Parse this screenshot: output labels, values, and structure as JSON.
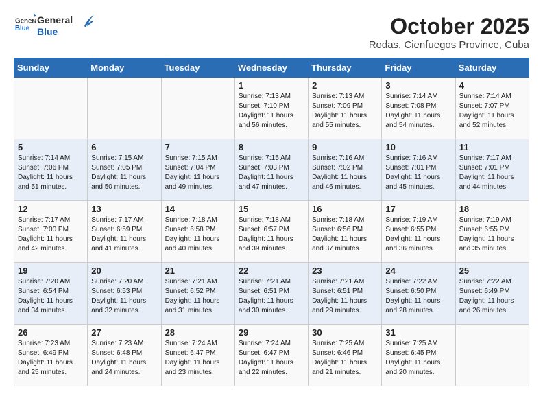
{
  "header": {
    "logo_line1": "General",
    "logo_line2": "Blue",
    "month": "October 2025",
    "location": "Rodas, Cienfuegos Province, Cuba"
  },
  "weekdays": [
    "Sunday",
    "Monday",
    "Tuesday",
    "Wednesday",
    "Thursday",
    "Friday",
    "Saturday"
  ],
  "weeks": [
    [
      {
        "day": "",
        "info": ""
      },
      {
        "day": "",
        "info": ""
      },
      {
        "day": "",
        "info": ""
      },
      {
        "day": "1",
        "info": "Sunrise: 7:13 AM\nSunset: 7:10 PM\nDaylight: 11 hours and 56 minutes."
      },
      {
        "day": "2",
        "info": "Sunrise: 7:13 AM\nSunset: 7:09 PM\nDaylight: 11 hours and 55 minutes."
      },
      {
        "day": "3",
        "info": "Sunrise: 7:14 AM\nSunset: 7:08 PM\nDaylight: 11 hours and 54 minutes."
      },
      {
        "day": "4",
        "info": "Sunrise: 7:14 AM\nSunset: 7:07 PM\nDaylight: 11 hours and 52 minutes."
      }
    ],
    [
      {
        "day": "5",
        "info": "Sunrise: 7:14 AM\nSunset: 7:06 PM\nDaylight: 11 hours and 51 minutes."
      },
      {
        "day": "6",
        "info": "Sunrise: 7:15 AM\nSunset: 7:05 PM\nDaylight: 11 hours and 50 minutes."
      },
      {
        "day": "7",
        "info": "Sunrise: 7:15 AM\nSunset: 7:04 PM\nDaylight: 11 hours and 49 minutes."
      },
      {
        "day": "8",
        "info": "Sunrise: 7:15 AM\nSunset: 7:03 PM\nDaylight: 11 hours and 47 minutes."
      },
      {
        "day": "9",
        "info": "Sunrise: 7:16 AM\nSunset: 7:02 PM\nDaylight: 11 hours and 46 minutes."
      },
      {
        "day": "10",
        "info": "Sunrise: 7:16 AM\nSunset: 7:01 PM\nDaylight: 11 hours and 45 minutes."
      },
      {
        "day": "11",
        "info": "Sunrise: 7:17 AM\nSunset: 7:01 PM\nDaylight: 11 hours and 44 minutes."
      }
    ],
    [
      {
        "day": "12",
        "info": "Sunrise: 7:17 AM\nSunset: 7:00 PM\nDaylight: 11 hours and 42 minutes."
      },
      {
        "day": "13",
        "info": "Sunrise: 7:17 AM\nSunset: 6:59 PM\nDaylight: 11 hours and 41 minutes."
      },
      {
        "day": "14",
        "info": "Sunrise: 7:18 AM\nSunset: 6:58 PM\nDaylight: 11 hours and 40 minutes."
      },
      {
        "day": "15",
        "info": "Sunrise: 7:18 AM\nSunset: 6:57 PM\nDaylight: 11 hours and 39 minutes."
      },
      {
        "day": "16",
        "info": "Sunrise: 7:18 AM\nSunset: 6:56 PM\nDaylight: 11 hours and 37 minutes."
      },
      {
        "day": "17",
        "info": "Sunrise: 7:19 AM\nSunset: 6:55 PM\nDaylight: 11 hours and 36 minutes."
      },
      {
        "day": "18",
        "info": "Sunrise: 7:19 AM\nSunset: 6:55 PM\nDaylight: 11 hours and 35 minutes."
      }
    ],
    [
      {
        "day": "19",
        "info": "Sunrise: 7:20 AM\nSunset: 6:54 PM\nDaylight: 11 hours and 34 minutes."
      },
      {
        "day": "20",
        "info": "Sunrise: 7:20 AM\nSunset: 6:53 PM\nDaylight: 11 hours and 32 minutes."
      },
      {
        "day": "21",
        "info": "Sunrise: 7:21 AM\nSunset: 6:52 PM\nDaylight: 11 hours and 31 minutes."
      },
      {
        "day": "22",
        "info": "Sunrise: 7:21 AM\nSunset: 6:51 PM\nDaylight: 11 hours and 30 minutes."
      },
      {
        "day": "23",
        "info": "Sunrise: 7:21 AM\nSunset: 6:51 PM\nDaylight: 11 hours and 29 minutes."
      },
      {
        "day": "24",
        "info": "Sunrise: 7:22 AM\nSunset: 6:50 PM\nDaylight: 11 hours and 28 minutes."
      },
      {
        "day": "25",
        "info": "Sunrise: 7:22 AM\nSunset: 6:49 PM\nDaylight: 11 hours and 26 minutes."
      }
    ],
    [
      {
        "day": "26",
        "info": "Sunrise: 7:23 AM\nSunset: 6:49 PM\nDaylight: 11 hours and 25 minutes."
      },
      {
        "day": "27",
        "info": "Sunrise: 7:23 AM\nSunset: 6:48 PM\nDaylight: 11 hours and 24 minutes."
      },
      {
        "day": "28",
        "info": "Sunrise: 7:24 AM\nSunset: 6:47 PM\nDaylight: 11 hours and 23 minutes."
      },
      {
        "day": "29",
        "info": "Sunrise: 7:24 AM\nSunset: 6:47 PM\nDaylight: 11 hours and 22 minutes."
      },
      {
        "day": "30",
        "info": "Sunrise: 7:25 AM\nSunset: 6:46 PM\nDaylight: 11 hours and 21 minutes."
      },
      {
        "day": "31",
        "info": "Sunrise: 7:25 AM\nSunset: 6:45 PM\nDaylight: 11 hours and 20 minutes."
      },
      {
        "day": "",
        "info": ""
      }
    ]
  ]
}
